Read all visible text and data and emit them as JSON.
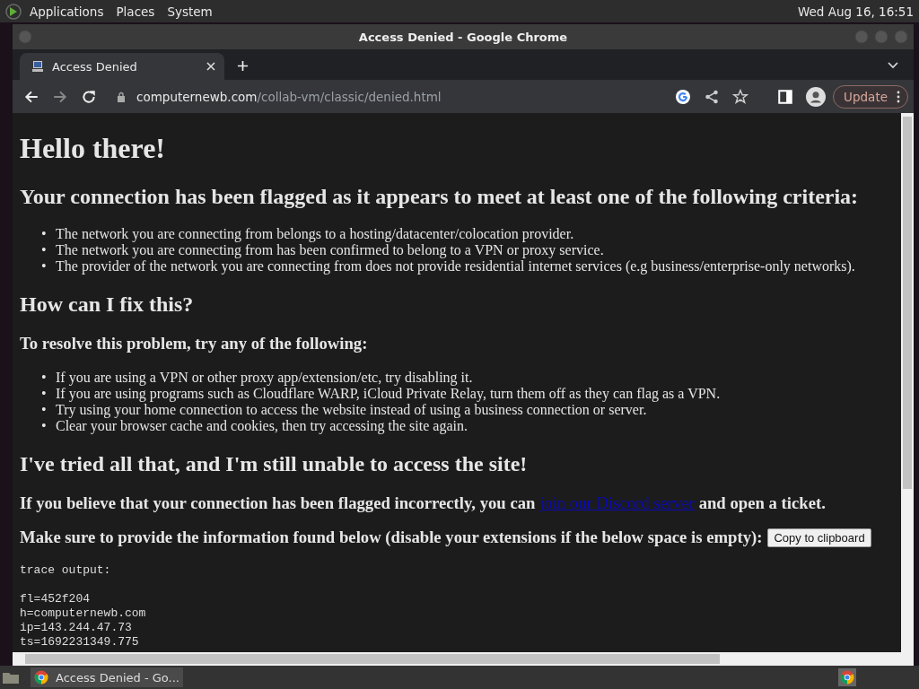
{
  "top_panel": {
    "menus": [
      "Applications",
      "Places",
      "System"
    ],
    "clock": "Wed Aug 16, 16:51"
  },
  "window": {
    "title": "Access Denied - Google Chrome"
  },
  "tabs": [
    {
      "label": "Access Denied",
      "selected": true
    }
  ],
  "address_bar": {
    "domain": "computernewb.com",
    "path": "/collab-vm/classic/denied.html"
  },
  "update_button": "Update",
  "page": {
    "heading": "Hello there!",
    "bullet": "•",
    "criteria_heading": "Your connection has been flagged as it appears to meet at least one of the following criteria:",
    "criteria": [
      "The network you are connecting from belongs to a hosting/datacenter/colocation provider.",
      "The network you are connecting from has been confirmed to belong to a VPN or proxy service.",
      "The provider of the network you are connecting from does not provide residential internet services (e.g business/enterprise-only networks)."
    ],
    "fix_heading": "How can I fix this?",
    "resolve_heading": "To resolve this problem, try any of the following:",
    "steps": [
      "If you are using a VPN or other proxy app/extension/etc, try disabling it.",
      "If you are using programs such as Cloudflare WARP, iCloud Private Relay, turn them off as they can flag as a VPN.",
      "Try using your home connection to access the website instead of using a business connection or server.",
      "Clear your browser cache and cookies, then try accessing the site again."
    ],
    "tried_heading": "I've tried all that, and I'm still unable to access the site!",
    "contact": {
      "before": "If you believe that your connection has been flagged incorrectly, you can",
      "link": "join our Discord server",
      "after": "and open a ticket."
    },
    "provide_text": "Make sure to provide the information found below (disable your extensions if the below space is empty):",
    "copy_button": "Copy to clipboard",
    "trace": {
      "title": "trace output:",
      "lines": [
        "fl=452f204",
        "h=computernewb.com",
        "ip=143.244.47.73",
        "ts=1692231349.775"
      ]
    }
  },
  "taskbar": {
    "items": [
      {
        "label": "Access Denied - Go..."
      }
    ]
  }
}
